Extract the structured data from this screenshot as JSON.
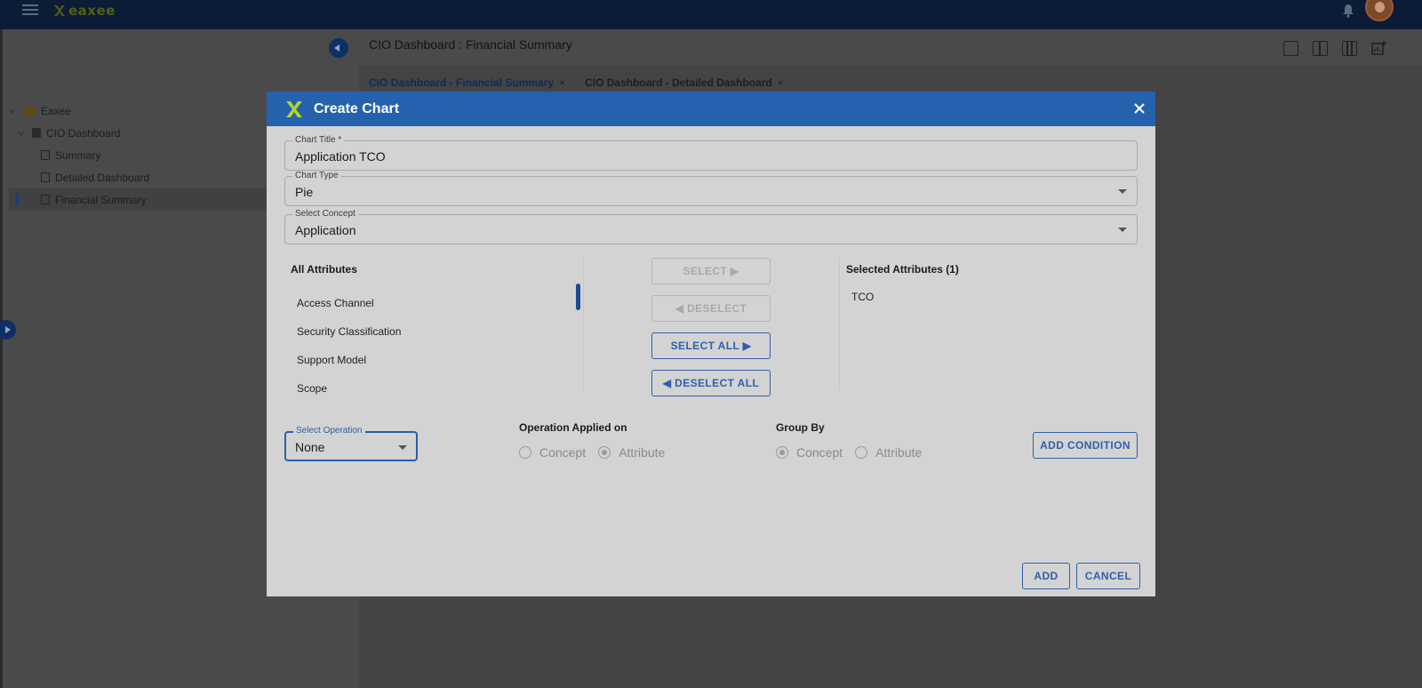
{
  "topbar": {
    "brand": "eaxee",
    "icons": [
      "menu-icon",
      "bell-icon",
      "avatar"
    ]
  },
  "page": {
    "title": "CIO Dashboard : Financial Summary"
  },
  "sidebar": {
    "tree": [
      {
        "label": "Eaxee",
        "icon": "folder-icon"
      },
      {
        "label": "CIO Dashboard",
        "icon": "calculator-icon"
      },
      {
        "label": "Summary",
        "icon": "document-icon"
      },
      {
        "label": "Detailed Dashboard",
        "icon": "document-icon"
      },
      {
        "label": "Financial Summary",
        "icon": "document-icon",
        "active": true
      }
    ]
  },
  "tabs": [
    {
      "label": "CIO Dashboard - Financial Summary",
      "close": "×",
      "active": true
    },
    {
      "label": "CIO Dashboard - Detailed Dashboard",
      "close": "×",
      "active": false
    }
  ],
  "modal": {
    "title": "Create Chart",
    "chart_title": {
      "label": "Chart Title *",
      "value": "Application TCO"
    },
    "chart_type": {
      "label": "Chart Type",
      "value": "Pie"
    },
    "concept": {
      "label": "Select Concept",
      "value": "Application"
    },
    "all_attributes": {
      "title": "All Attributes",
      "items": [
        "Access Channel",
        "Security Classification",
        "Support Model",
        "Scope"
      ]
    },
    "selected_attributes": {
      "title": "Selected Attributes (1)",
      "items": [
        "TCO"
      ]
    },
    "transfer_buttons": {
      "select": "SELECT ▶",
      "deselect": "◀ DESELECT",
      "select_all": "SELECT ALL ▶",
      "deselect_all": "◀ DESELECT ALL"
    },
    "operation": {
      "label": "Select Operation",
      "value": "None"
    },
    "operation_applied_on": {
      "title": "Operation Applied on",
      "options": [
        "Concept",
        "Attribute"
      ],
      "selected": "Attribute"
    },
    "group_by": {
      "title": "Group By",
      "options": [
        "Concept",
        "Attribute"
      ],
      "selected": "Concept"
    },
    "add_condition": "ADD CONDITION",
    "add": "ADD",
    "cancel": "CANCEL"
  },
  "colors": {
    "header_blue": "#2462ad",
    "button_blue": "#2f5faa",
    "navbar": "#0b1c36"
  }
}
